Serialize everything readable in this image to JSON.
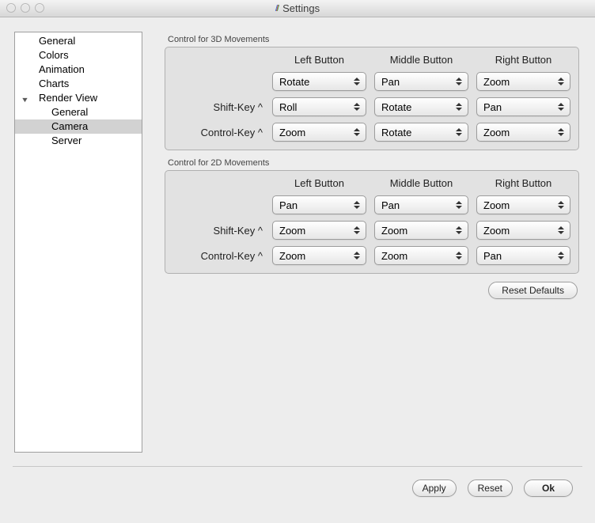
{
  "window": {
    "title": "Settings"
  },
  "sidebar": {
    "items": [
      {
        "label": "General"
      },
      {
        "label": "Colors"
      },
      {
        "label": "Animation"
      },
      {
        "label": "Charts"
      },
      {
        "label": "Render View",
        "expanded": true
      },
      {
        "label": "General"
      },
      {
        "label": "Camera"
      },
      {
        "label": "Server"
      }
    ],
    "selected": "Camera"
  },
  "groups": {
    "g3d": {
      "title": "Control for 3D Movements",
      "columns": {
        "left": "Left Button",
        "middle": "Middle Button",
        "right": "Right Button"
      },
      "rows": {
        "none": {
          "label": "",
          "left": "Rotate",
          "middle": "Pan",
          "right": "Zoom"
        },
        "shift": {
          "label": "Shift-Key ^",
          "left": "Roll",
          "middle": "Rotate",
          "right": "Pan"
        },
        "control": {
          "label": "Control-Key ^",
          "left": "Zoom",
          "middle": "Rotate",
          "right": "Zoom"
        }
      }
    },
    "g2d": {
      "title": "Control for 2D Movements",
      "columns": {
        "left": "Left Button",
        "middle": "Middle Button",
        "right": "Right Button"
      },
      "rows": {
        "none": {
          "label": "",
          "left": "Pan",
          "middle": "Pan",
          "right": "Zoom"
        },
        "shift": {
          "label": "Shift-Key ^",
          "left": "Zoom",
          "middle": "Zoom",
          "right": "Zoom"
        },
        "control": {
          "label": "Control-Key ^",
          "left": "Zoom",
          "middle": "Zoom",
          "right": "Pan"
        }
      }
    }
  },
  "buttons": {
    "reset_defaults": "Reset Defaults",
    "apply": "Apply",
    "reset": "Reset",
    "ok": "Ok"
  }
}
